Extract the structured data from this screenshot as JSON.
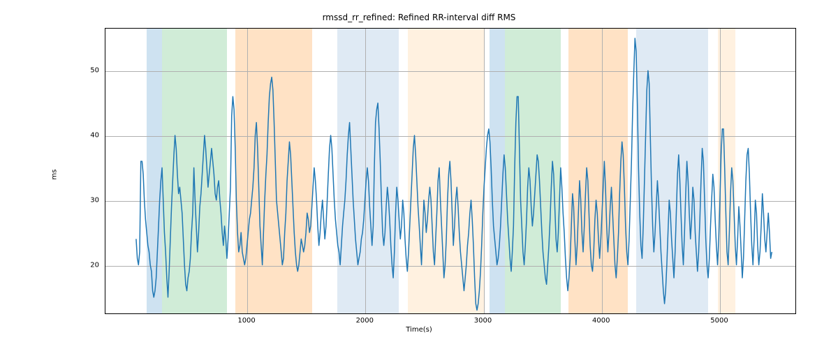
{
  "chart_data": {
    "type": "line",
    "title": "rmssd_rr_refined: Refined RR-interval diff RMS",
    "xlabel": "Time(s)",
    "ylabel": "ms",
    "xlim": [
      -200,
      5650
    ],
    "ylim": [
      12.5,
      56.5
    ],
    "x_ticks": [
      1000,
      2000,
      3000,
      4000,
      5000
    ],
    "y_ticks": [
      20,
      30,
      40,
      50
    ],
    "bands": [
      {
        "x0": 150,
        "x1": 280,
        "color": "#5c9fcf"
      },
      {
        "x0": 280,
        "x1": 830,
        "color": "#62bf79"
      },
      {
        "x0": 900,
        "x1": 1550,
        "color": "#ff9f40"
      },
      {
        "x0": 1760,
        "x1": 2280,
        "color": "#96b8db"
      },
      {
        "x0": 2360,
        "x1": 3010,
        "color": "#ffcf99"
      },
      {
        "x0": 3050,
        "x1": 3180,
        "color": "#5c9fcf"
      },
      {
        "x0": 3180,
        "x1": 3650,
        "color": "#62bf79"
      },
      {
        "x0": 3720,
        "x1": 4220,
        "color": "#ff9f40"
      },
      {
        "x0": 4290,
        "x1": 4900,
        "color": "#96b8db"
      },
      {
        "x0": 4980,
        "x1": 5130,
        "color": "#ffcf99"
      }
    ],
    "series": [
      {
        "name": "rmssd_rr_refined",
        "x_start": 60,
        "x_step": 10,
        "values": [
          24,
          21,
          20,
          22,
          36,
          36,
          34,
          30,
          27,
          25,
          23,
          22,
          20,
          19,
          16,
          15,
          16,
          18,
          22,
          26,
          30,
          33,
          35,
          30,
          25,
          22,
          18,
          15,
          19,
          24,
          29,
          33,
          37,
          40,
          38,
          34,
          31,
          32,
          30,
          28,
          24,
          20,
          17,
          16,
          18,
          19,
          21,
          25,
          28,
          35,
          30,
          26,
          22,
          25,
          29,
          31,
          34,
          37,
          40,
          38,
          35,
          32,
          34,
          36,
          38,
          36,
          34,
          31,
          30,
          32,
          33,
          30,
          28,
          25,
          23,
          26,
          24,
          21,
          24,
          28,
          32,
          43,
          46,
          44,
          38,
          30,
          25,
          22,
          23,
          25,
          22,
          21,
          20,
          21,
          23,
          25,
          27,
          28,
          30,
          32,
          35,
          40,
          42,
          38,
          32,
          26,
          23,
          20,
          25,
          30,
          34,
          37,
          42,
          46,
          48,
          49,
          47,
          42,
          36,
          30,
          28,
          26,
          24,
          22,
          20,
          21,
          25,
          28,
          33,
          36,
          39,
          37,
          33,
          29,
          25,
          22,
          20,
          19,
          20,
          22,
          24,
          23,
          22,
          23,
          25,
          28,
          27,
          25,
          26,
          29,
          32,
          35,
          33,
          30,
          26,
          23,
          25,
          28,
          30,
          27,
          24,
          26,
          30,
          34,
          38,
          40,
          38,
          34,
          30,
          27,
          25,
          23,
          22,
          20,
          23,
          26,
          28,
          30,
          33,
          37,
          40,
          42,
          38,
          34,
          30,
          27,
          24,
          22,
          20,
          21,
          22,
          24,
          25,
          27,
          30,
          33,
          35,
          33,
          29,
          26,
          23,
          26,
          35,
          42,
          44,
          45,
          41,
          36,
          30,
          25,
          23,
          25,
          29,
          32,
          30,
          27,
          23,
          20,
          18,
          22,
          28,
          32,
          30,
          27,
          24,
          26,
          30,
          28,
          24,
          21,
          19,
          22,
          26,
          30,
          34,
          38,
          40,
          37,
          33,
          29,
          26,
          23,
          20,
          25,
          30,
          28,
          25,
          27,
          30,
          32,
          30,
          26,
          22,
          20,
          24,
          28,
          33,
          35,
          30,
          26,
          22,
          18,
          20,
          24,
          30,
          34,
          36,
          33,
          28,
          23,
          26,
          30,
          32,
          29,
          25,
          22,
          20,
          18,
          16,
          18,
          20,
          23,
          25,
          28,
          30,
          27,
          23,
          18,
          14,
          13,
          14,
          16,
          19,
          23,
          28,
          32,
          35,
          38,
          40,
          41,
          39,
          35,
          30,
          26,
          24,
          22,
          20,
          21,
          23,
          26,
          30,
          34,
          37,
          35,
          31,
          27,
          24,
          21,
          19,
          22,
          26,
          35,
          42,
          46,
          46,
          38,
          30,
          26,
          22,
          20,
          23,
          27,
          32,
          35,
          33,
          29,
          26,
          28,
          31,
          34,
          37,
          36,
          33,
          29,
          25,
          22,
          20,
          18,
          17,
          20,
          23,
          27,
          32,
          36,
          34,
          29,
          24,
          22,
          25,
          30,
          35,
          32,
          28,
          25,
          21,
          18,
          16,
          18,
          21,
          26,
          31,
          29,
          24,
          20,
          23,
          28,
          33,
          30,
          25,
          22,
          26,
          31,
          35,
          33,
          28,
          23,
          20,
          19,
          22,
          27,
          30,
          28,
          24,
          21,
          24,
          28,
          32,
          36,
          32,
          26,
          22,
          25,
          29,
          32,
          28,
          24,
          20,
          18,
          21,
          25,
          31,
          36,
          39,
          37,
          32,
          26,
          22,
          20,
          24,
          30,
          36,
          44,
          50,
          55,
          53,
          45,
          35,
          28,
          23,
          21,
          26,
          33,
          40,
          47,
          50,
          48,
          40,
          32,
          26,
          22,
          25,
          29,
          33,
          30,
          26,
          22,
          19,
          16,
          14,
          16,
          20,
          25,
          30,
          28,
          24,
          21,
          18,
          22,
          28,
          34,
          37,
          33,
          28,
          23,
          20,
          25,
          31,
          36,
          33,
          28,
          24,
          27,
          32,
          30,
          25,
          22,
          19,
          22,
          27,
          33,
          38,
          36,
          30,
          24,
          20,
          18,
          21,
          26,
          30,
          34,
          32,
          27,
          23,
          20,
          24,
          30,
          37,
          41,
          41,
          35,
          28,
          22,
          20,
          25,
          31,
          35,
          33,
          28,
          23,
          20,
          24,
          29,
          26,
          22,
          18,
          21,
          27,
          33,
          37,
          38,
          34,
          28,
          23,
          20,
          24,
          30,
          28,
          23,
          20,
          22,
          26,
          31,
          28,
          24,
          22,
          25,
          28,
          25,
          21,
          22
        ]
      }
    ]
  }
}
